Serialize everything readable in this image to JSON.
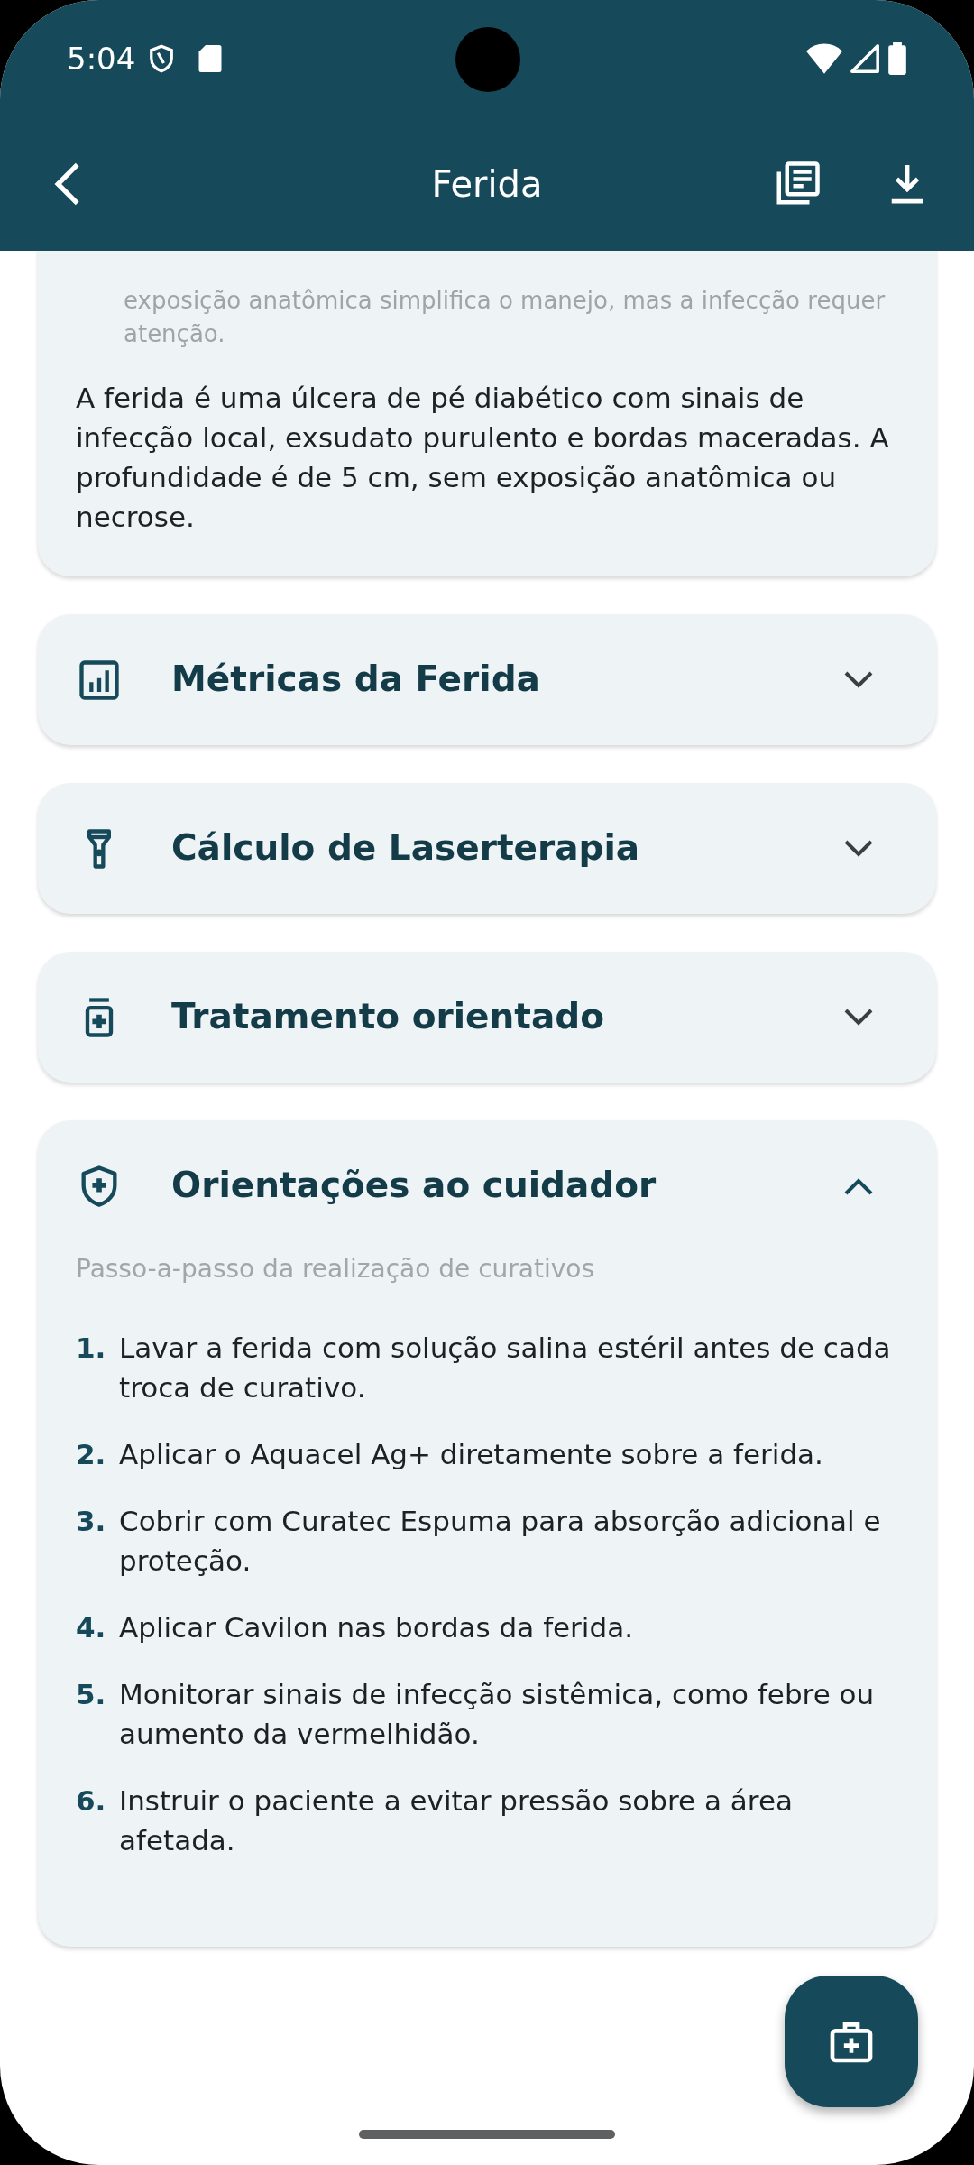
{
  "status_bar": {
    "time": "5:04"
  },
  "app_bar": {
    "title": "Ferida"
  },
  "summary_card": {
    "faded_text": "exposição anatômica simplifica o manejo, mas a infecção requer atenção.",
    "description": "A ferida é uma úlcera de pé diabético com sinais de infecção local, exsudato purulento e bordas maceradas. A profundidade é de 5 cm, sem exposição anatômica ou necrose."
  },
  "sections": [
    {
      "title": "Métricas da Ferida",
      "expanded": false
    },
    {
      "title": "Cálculo de Laserterapia",
      "expanded": false
    },
    {
      "title": "Tratamento orientado",
      "expanded": false
    },
    {
      "title": "Orientações ao cuidador",
      "expanded": true,
      "subtitle": "Passo-a-passo da realização de curativos",
      "steps": [
        {
          "number": "1.",
          "text": "Lavar a ferida com solução salina estéril antes de cada troca de curativo."
        },
        {
          "number": "2.",
          "text": "Aplicar o Aquacel Ag+ diretamente sobre a ferida."
        },
        {
          "number": "3.",
          "text": "Cobrir com Curatec Espuma para absorção adicional e proteção."
        },
        {
          "number": "4.",
          "text": "Aplicar Cavilon nas bordas da ferida."
        },
        {
          "number": "5.",
          "text": "Monitorar sinais de infecção sistêmica, como febre ou aumento da vermelhidão."
        },
        {
          "number": "6.",
          "text": "Instruir o paciente a evitar pressão sobre a área afetada."
        }
      ]
    }
  ]
}
